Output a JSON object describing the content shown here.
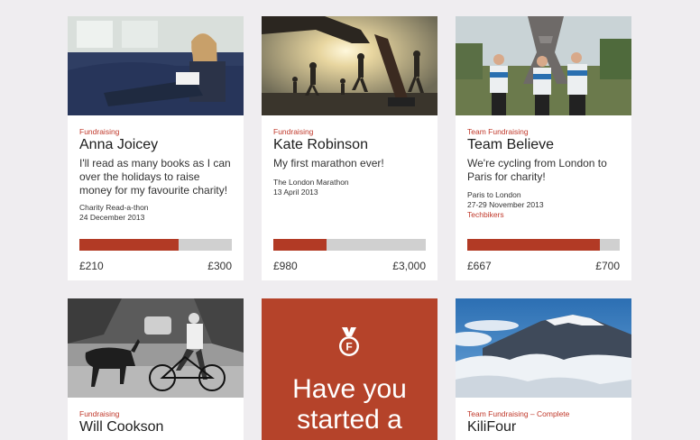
{
  "cards": [
    {
      "tag": "Fundraising",
      "name": "Anna Joicey",
      "description": "I'll read as many books as I can over the holidays to raise money for my favourite charity!",
      "event": "Charity Read-a-thon",
      "date": "24 December 2013",
      "team": "",
      "raised": "£210",
      "target": "£300",
      "progress": 0.65,
      "image": "girl-reading-photo"
    },
    {
      "tag": "Fundraising",
      "name": "Kate Robinson",
      "description": "My first marathon ever!",
      "event": "The London Marathon",
      "date": "13 April 2013",
      "team": "",
      "raised": "£980",
      "target": "£3,000",
      "progress": 0.35,
      "image": "marathon-runners-photo"
    },
    {
      "tag": "Team Fundraising",
      "name": "Team Believe",
      "description": "We're cycling from London to Paris for charity!",
      "event": "Paris to London",
      "date": "27-29 November 2013",
      "team": "Techbikers",
      "raised": "£667",
      "target": "£700",
      "progress": 0.87,
      "image": "cyclists-eiffel-tower-photo"
    },
    {
      "tag": "Fundraising",
      "name": "Will Cookson",
      "image": "cyclist-deer-photo"
    },
    {
      "cta_text": "Have you started a",
      "icon": "medal-icon"
    },
    {
      "tag": "Team Fundraising – Complete",
      "name": "KiliFour",
      "image": "kilimanjaro-photo"
    }
  ],
  "colors": {
    "accent": "#c0392b",
    "progress_fill": "#b23a25",
    "progress_track": "#d0d0d0",
    "cta_background": "#b5432a",
    "page_background": "#efedf0"
  }
}
